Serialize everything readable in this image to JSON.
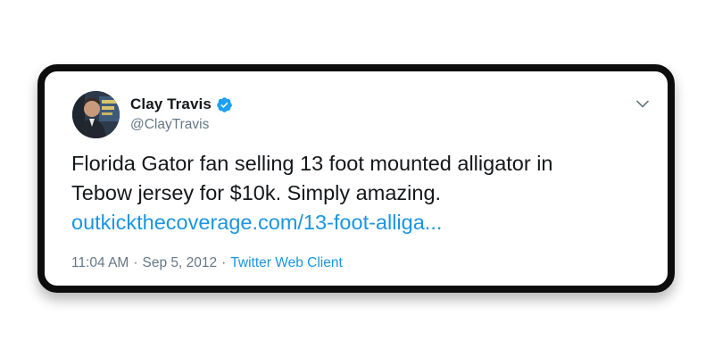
{
  "tweet": {
    "display_name": "Clay Travis",
    "handle": "@ClayTravis",
    "verified": true,
    "text_line1": "Florida Gator fan selling 13 foot mounted alligator in",
    "text_line2": "Tebow jersey for $10k. Simply amazing.",
    "link_text": "outkickthecoverage.com/13-foot-alliga...",
    "time": "11:04 AM",
    "separator": "·",
    "date": "Sep 5, 2012",
    "client": "Twitter Web Client"
  },
  "icons": {
    "verified": "verified-badge-icon",
    "menu": "chevron-down-icon"
  },
  "colors": {
    "text": "#14171a",
    "secondary": "#657786",
    "link": "#1b95e0",
    "card_border": "#0d0d0d"
  }
}
